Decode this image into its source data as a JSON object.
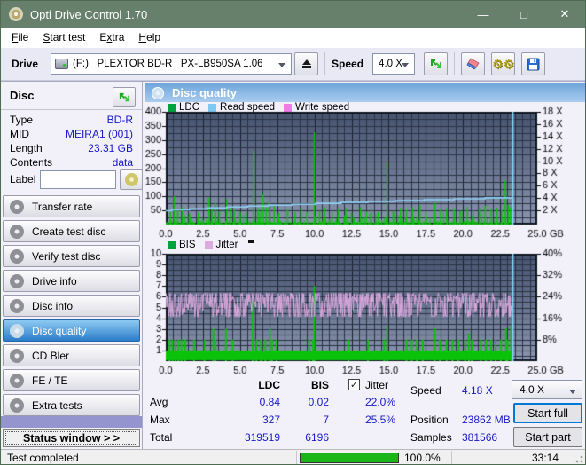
{
  "window": {
    "title": "Opti Drive Control 1.70",
    "minimize": "—",
    "maximize": "□",
    "close": "✕"
  },
  "menu": {
    "items": [
      {
        "label": "File",
        "u": 0
      },
      {
        "label": "Start test",
        "u": 0
      },
      {
        "label": "Extra",
        "u": 1
      },
      {
        "label": "Help",
        "u": 0
      }
    ]
  },
  "toolbar": {
    "drive_label": "Drive",
    "drive_value": "(F:)   PLEXTOR BD-R   PX-LB950SA 1.06",
    "speed_label": "Speed",
    "speed_value": "4.0 X"
  },
  "disc_panel": {
    "title": "Disc",
    "rows": [
      {
        "label": "Type",
        "value": "BD-R"
      },
      {
        "label": "MID",
        "value": "MEIRA1 (001)"
      },
      {
        "label": "Length",
        "value": "23.31 GB"
      },
      {
        "label": "Contents",
        "value": "data"
      }
    ],
    "label_field": {
      "label": "Label",
      "value": ""
    }
  },
  "sidebar": {
    "items": [
      "Transfer rate",
      "Create test disc",
      "Verify test disc",
      "Drive info",
      "Disc info",
      "Disc quality",
      "CD Bler",
      "FE / TE",
      "Extra tests"
    ],
    "selected": "Disc quality",
    "status_button": "Status window > >"
  },
  "main": {
    "header": "Disc quality"
  },
  "chart_data": [
    {
      "type": "line",
      "title": "LDC errors and read/write speed vs disc position",
      "legend": [
        {
          "label": "LDC",
          "color": "#00A33C"
        },
        {
          "label": "Read speed",
          "color": "#7EC9F2"
        },
        {
          "label": "Write speed",
          "color": "#F07CE8"
        }
      ],
      "x_ticks": [
        "0.0",
        "2.5",
        "5.0",
        "7.5",
        "10.0",
        "12.5",
        "15.0",
        "17.5",
        "20.0",
        "22.5",
        "25.0"
      ],
      "x_unit": "GB",
      "x_max": 25,
      "data_end_gb": 23.35,
      "y_left": {
        "ticks": [
          400,
          350,
          300,
          250,
          200,
          150,
          100,
          50
        ],
        "max": 400
      },
      "y_right": {
        "ticks": [
          "18 X",
          "16 X",
          "14 X",
          "12 X",
          "10 X",
          "8 X",
          "6 X",
          "4 X",
          "2 X"
        ],
        "top_unit": 400,
        "bottom_unit": 50
      },
      "grid": {
        "h_step_units": 25,
        "v_step_gb": 0.5,
        "v_major_gb": 2.5
      },
      "series": {
        "ldc_noise": {
          "seed": 11,
          "step_gb": 0.05,
          "base_max": 14,
          "burst_max": 36,
          "burst_prob": 0.18
        },
        "ldc_spikes": [
          [
            0.3,
            45
          ],
          [
            0.55,
            100
          ],
          [
            0.8,
            55
          ],
          [
            1.1,
            62
          ],
          [
            1.6,
            40
          ],
          [
            2.2,
            42
          ],
          [
            2.9,
            95
          ],
          [
            3.1,
            58
          ],
          [
            3.35,
            76
          ],
          [
            3.6,
            48
          ],
          [
            4.1,
            92
          ],
          [
            4.35,
            60
          ],
          [
            4.6,
            52
          ],
          [
            5.0,
            46
          ],
          [
            5.4,
            42
          ],
          [
            5.9,
            260
          ],
          [
            6.2,
            58
          ],
          [
            6.55,
            106
          ],
          [
            6.75,
            60
          ],
          [
            6.95,
            78
          ],
          [
            7.3,
            66
          ],
          [
            7.6,
            42
          ],
          [
            8.2,
            56
          ],
          [
            8.7,
            44
          ],
          [
            9.1,
            60
          ],
          [
            9.5,
            44
          ],
          [
            10.0,
            327
          ],
          [
            10.35,
            48
          ],
          [
            10.7,
            62
          ],
          [
            11.2,
            44
          ],
          [
            11.6,
            56
          ],
          [
            12.1,
            60
          ],
          [
            12.5,
            44
          ],
          [
            13.1,
            62
          ],
          [
            13.5,
            46
          ],
          [
            13.85,
            58
          ],
          [
            14.3,
            44
          ],
          [
            14.9,
            225
          ],
          [
            15.3,
            48
          ],
          [
            15.8,
            60
          ],
          [
            16.2,
            52
          ],
          [
            16.6,
            62
          ],
          [
            17.1,
            68
          ],
          [
            17.5,
            46
          ],
          [
            18.1,
            76
          ],
          [
            18.5,
            52
          ],
          [
            18.9,
            58
          ],
          [
            19.4,
            56
          ],
          [
            19.8,
            48
          ],
          [
            20.3,
            62
          ],
          [
            20.7,
            52
          ],
          [
            21.1,
            58
          ],
          [
            21.5,
            66
          ],
          [
            21.9,
            56
          ],
          [
            22.3,
            60
          ],
          [
            22.6,
            52
          ],
          [
            22.85,
            155
          ],
          [
            23.05,
            70
          ],
          [
            23.2,
            62
          ]
        ],
        "read_speed": {
          "start_x": 2.05,
          "end_x": 4.18,
          "curve": "sqrt",
          "quantize_x": 0.15
        },
        "end_marker_gb": 23.35
      }
    },
    {
      "type": "line",
      "title": "BIS errors and jitter vs disc position",
      "legend": [
        {
          "label": "BIS",
          "color": "#00A33C"
        },
        {
          "label": "Jitter",
          "color": "#DCAADF"
        }
      ],
      "x_ticks": [
        "0.0",
        "2.5",
        "5.0",
        "7.5",
        "10.0",
        "12.5",
        "15.0",
        "17.5",
        "20.0",
        "22.5",
        "25.0"
      ],
      "x_unit": "GB",
      "x_max": 25,
      "data_end_gb": 23.35,
      "y_left": {
        "ticks": [
          10,
          9,
          8,
          7,
          6,
          5,
          4,
          3,
          2,
          1
        ],
        "max": 10
      },
      "y_right": {
        "ticks": [
          "40%",
          "32%",
          "24%",
          "16%",
          "8%"
        ],
        "tick_units": [
          10,
          8,
          6,
          4,
          2
        ]
      },
      "grid": {
        "h_step_units": 0.5,
        "v_step_gb": 0.5,
        "v_major_gb": 2.5
      },
      "series": {
        "bis_band_level": 1,
        "bis_minor_spikes": [
          0.25,
          0.45,
          0.65,
          0.85,
          1.05,
          1.3,
          1.9,
          2.6,
          3.35,
          4.5,
          6.1,
          6.4,
          6.7,
          7.15,
          7.45,
          9.65,
          9.9,
          12.3,
          13.6,
          14.7,
          16.2,
          16.55,
          16.9,
          17.3,
          18.45,
          18.9,
          19.3,
          19.7,
          20.15,
          20.6,
          21.2,
          21.55,
          21.9,
          22.2,
          22.55,
          23.0
        ],
        "bis_minor_level": 2,
        "bis_major_spikes": [
          [
            3.2,
            3
          ],
          [
            4.05,
            3
          ],
          [
            5.85,
            5.6
          ],
          [
            7.0,
            3
          ],
          [
            10.0,
            7
          ],
          [
            14.9,
            3.3
          ],
          [
            18.1,
            3.05
          ],
          [
            20.4,
            2.6
          ],
          [
            22.9,
            3.05
          ],
          [
            23.25,
            3.3
          ]
        ],
        "jitter": {
          "seed": 23,
          "step_gb": 0.045,
          "avg_pct": 22.0,
          "min_pct": 16.4,
          "max_pct": 25.5
        },
        "end_marker_gb": 23.35
      }
    }
  ],
  "stats": {
    "col_headers": [
      "LDC",
      "BIS"
    ],
    "jitter_label": "Jitter",
    "jitter_checked": true,
    "check_glyph": "✓",
    "rows": [
      {
        "label": "Avg",
        "ldc": "0.84",
        "bis": "0.02",
        "jitter": "22.0%"
      },
      {
        "label": "Max",
        "ldc": "327",
        "bis": "7",
        "jitter": "25.5%"
      },
      {
        "label": "Total",
        "ldc": "319519",
        "bis": "6196",
        "jitter": ""
      }
    ],
    "right": [
      {
        "label": "Speed",
        "value": "4.18 X"
      },
      {
        "label": "Position",
        "value": "23862 MB"
      },
      {
        "label": "Samples",
        "value": "381566"
      }
    ],
    "speed_select": "4.0 X",
    "start_full": "Start full",
    "start_part": "Start part"
  },
  "statusbar": {
    "status": "Test completed",
    "progress_pct": 100,
    "progress_label": "100.0%",
    "time": "33:14"
  },
  "colors": {
    "plot_top": "#46536F",
    "plot_bottom": "#8B96AF",
    "grid": "#2A3244",
    "grid_major": "#18202E",
    "plot_border": "#0D141E",
    "green": "#0BC20B",
    "read_line": "#8FD2F5",
    "jitter_line": "#DCAADF",
    "end_marker": "#7FD4F8",
    "tick_text": "#000000"
  }
}
